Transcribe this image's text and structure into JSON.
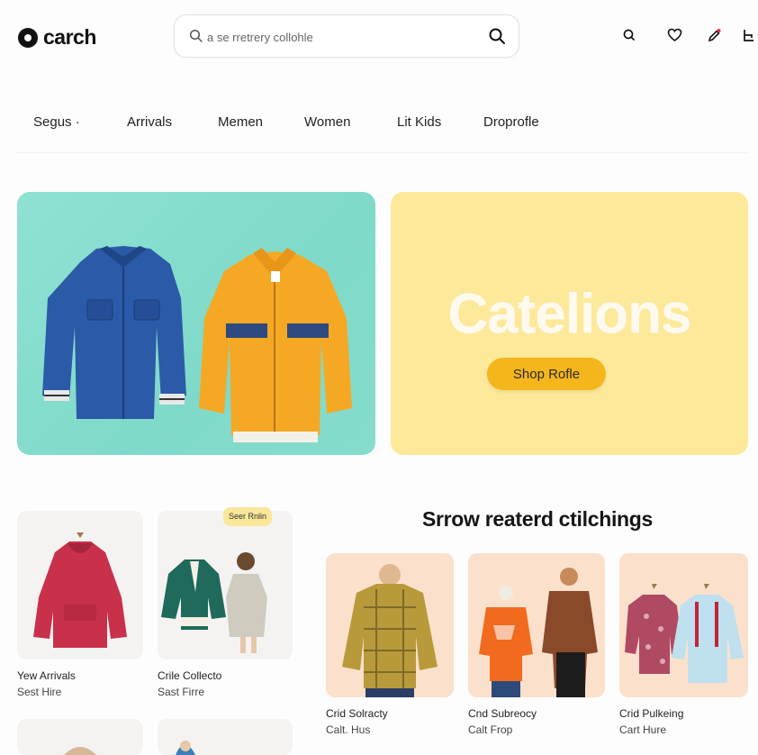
{
  "header": {
    "logo_text": "carch",
    "search_placeholder": "a se rretrery collohle",
    "icons": [
      "account-icon",
      "heart-icon",
      "edit-icon",
      "cart-icon"
    ]
  },
  "nav": {
    "items": [
      "Segus ·",
      "Arrivals",
      "Memen",
      "Women",
      "Lit Kids",
      "Droprofle"
    ]
  },
  "hero": {
    "title": "Catelions",
    "button_label": "Shop Rofle"
  },
  "left_cards": [
    {
      "title": "Yew Arrivals",
      "subtitle": "Sest Hire"
    },
    {
      "title": "Crile Collecto",
      "subtitle": "Sast Firre",
      "badge": "Seer Rnlin"
    }
  ],
  "section": {
    "title": "Srrow reaterd ctilchings"
  },
  "products": [
    {
      "title": "Crid Solracty",
      "subtitle": "Calt. Hus"
    },
    {
      "title": "Cnd Subreocy",
      "subtitle": "Calt Frop"
    },
    {
      "title": "Crid Pulkeing",
      "subtitle": "Cart Hure"
    }
  ],
  "colors": {
    "hero_left_bg": "#86dccd",
    "hero_right_bg": "#fde99a",
    "accent": "#f5b61c",
    "card_bg": "#f4f3f2",
    "product_bg": "#fbe1cc"
  }
}
